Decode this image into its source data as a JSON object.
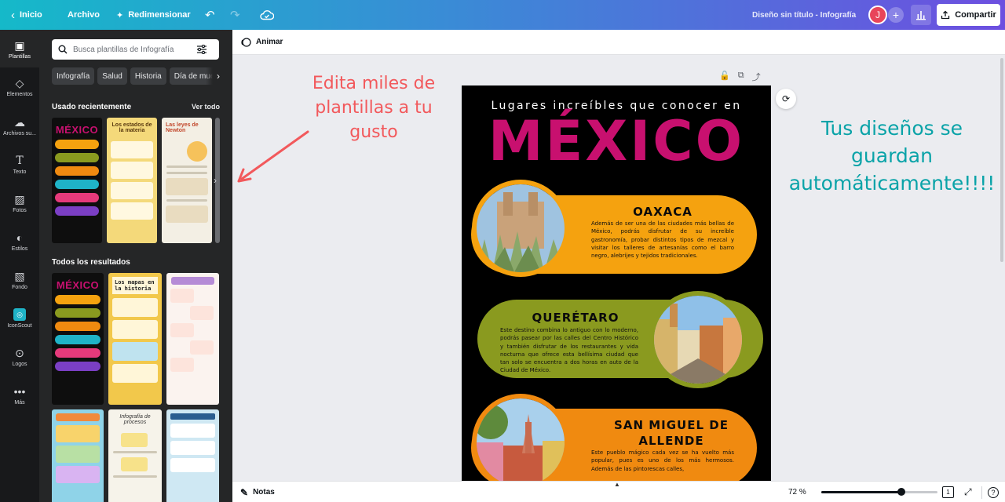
{
  "topbar": {
    "home_label": "Inicio",
    "file_label": "Archivo",
    "resize_label": "Redimensionar",
    "doc_title": "Diseño sin título - Infografía",
    "avatar_initial": "J",
    "share_label": "Compartir"
  },
  "rail": {
    "items": [
      {
        "label": "Plantillas",
        "icon": "templates-icon"
      },
      {
        "label": "Elementos",
        "icon": "elements-icon"
      },
      {
        "label": "Archivos su...",
        "icon": "upload-icon"
      },
      {
        "label": "Texto",
        "icon": "text-icon"
      },
      {
        "label": "Fotos",
        "icon": "photos-icon"
      },
      {
        "label": "Estilos",
        "icon": "styles-icon"
      },
      {
        "label": "Fondo",
        "icon": "background-icon"
      },
      {
        "label": "IconScout",
        "icon": "iconscout-icon"
      },
      {
        "label": "Logos",
        "icon": "logos-icon"
      },
      {
        "label": "Más",
        "icon": "more-icon"
      }
    ]
  },
  "panel": {
    "search_placeholder": "Busca plantillas de Infografía",
    "chips": [
      "Infografía",
      "Salud",
      "Historia",
      "Día de muertos"
    ],
    "recent_heading": "Usado recientemente",
    "see_all": "Ver todo",
    "results_heading": "Todos los resultados",
    "thumb_texts": {
      "mexico": "MÉXICO",
      "estados": "Los estados de la materia",
      "newton": "Las leyes de Newton",
      "mapas": "Los mapas en la historia",
      "procesos": "Infografía de procesos"
    }
  },
  "context_bar": {
    "animate_label": "Animar"
  },
  "design": {
    "subtitle": "Lugares increíbles que conocer en",
    "title": "MÉXICO",
    "places": [
      {
        "name": "OAXACA",
        "text": "Además de ser una de las ciudades más bellas de México, podrás disfrutar de su increíble gastronomía, probar distintos tipos de mezcal y visitar los talleres de artesanías como el barro negro, alebrijes y tejidos tradicionales."
      },
      {
        "name": "QUERÉTARO",
        "text": "Este destino combina lo antiguo con lo moderno, podrás pasear por las calles del Centro Histórico y también disfrutar de los restaurantes y vida nocturna que ofrece esta bellísima ciudad que tan solo se encuentra a dos horas en auto de la Ciudad de México."
      },
      {
        "name": "SAN MIGUEL DE ALLENDE",
        "text": "Este pueblo mágico cada vez se ha vuelto más popular, pues es uno de los más hermosos. Además de las pintorescas calles,"
      }
    ],
    "colors": {
      "title": "#c8106f",
      "oaxaca": "#f5a20f",
      "queretaro": "#8a9a1f",
      "sanmiguel": "#f08a10"
    }
  },
  "annotations": {
    "left": "Edita miles de plantillas a tu gusto",
    "right": "Tus diseños se guardan automáticamente!!!!"
  },
  "bottombar": {
    "notes_label": "Notas",
    "zoom_label": "72 %",
    "zoom_value": 72,
    "page_count": "1"
  }
}
